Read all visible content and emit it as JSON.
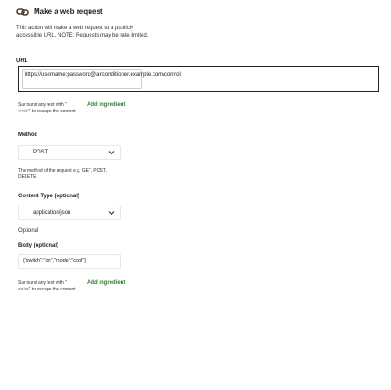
{
  "header": {
    "title": "Make a web request",
    "icon": "link-icon"
  },
  "description": "This action will make a web request to a publicly accessible URL. NOTE: Requests may be rate limited.",
  "url": {
    "label": "URL",
    "value": "https://username:password@airconditioner.example.com/control"
  },
  "url_helper": {
    "line1": "Surround any text with \"",
    "line2": "<<>>\" to escape the content",
    "add_ingredient": "Add ingredient"
  },
  "method": {
    "label": "Method",
    "selected": "POST",
    "helper_line1": "The method of the request e.g. GET, POST,",
    "helper_line2": "DELETE"
  },
  "content_type": {
    "label": "Content Type (optional)",
    "selected": "application/json",
    "note": "Optional"
  },
  "body": {
    "label": "Body (optional)",
    "value": "{\"switch\":\"on\",\"mode\":\"cool\"}"
  },
  "body_helper": {
    "line1": "Surround any text with \"",
    "line2": "<<>>\" to escape the content",
    "add_ingredient": "Add ingredient"
  },
  "colors": {
    "accent_green": "#2e7d32",
    "border_dark": "#222222",
    "border_light": "#e6e6e6"
  }
}
